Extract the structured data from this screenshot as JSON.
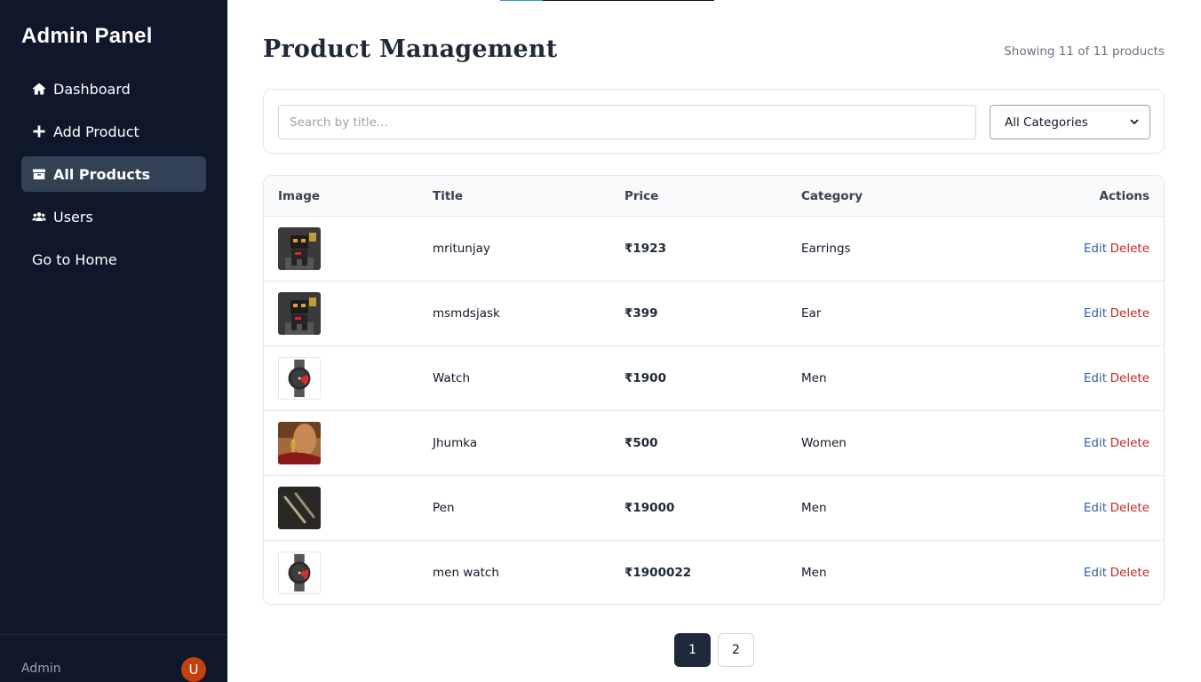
{
  "sidebar": {
    "brand": "Admin Panel",
    "items": [
      {
        "label": "Dashboard",
        "icon": "home-icon",
        "active": false
      },
      {
        "label": "Add Product",
        "icon": "plus-icon",
        "active": false
      },
      {
        "label": "All Products",
        "icon": "box-icon",
        "active": true
      },
      {
        "label": "Users",
        "icon": "users-icon",
        "active": false
      },
      {
        "label": "Go to Home",
        "icon": "",
        "active": false
      }
    ],
    "footer": {
      "user": "Admin",
      "avatar_letter": "U",
      "avatar_color": "#c2410c"
    }
  },
  "main": {
    "title": "Product Management",
    "count_text": "Showing 11 of 11 products",
    "search": {
      "placeholder": "Search by title...",
      "value": ""
    },
    "category_select": {
      "value": "All Categories"
    },
    "table": {
      "headers": {
        "image": "Image",
        "title": "Title",
        "price": "Price",
        "category": "Category",
        "actions": "Actions"
      },
      "rows": [
        {
          "title": "mritunjay",
          "price": "₹1923",
          "category": "Earrings",
          "image": "robot-thumbnail"
        },
        {
          "title": "msmdsjask",
          "price": "₹399",
          "category": "Ear",
          "image": "robot-thumbnail"
        },
        {
          "title": "Watch",
          "price": "₹1900",
          "category": "Men",
          "image": "watch-thumbnail"
        },
        {
          "title": "Jhumka",
          "price": "₹500",
          "category": "Women",
          "image": "jhumka-thumbnail"
        },
        {
          "title": "Pen",
          "price": "₹19000",
          "category": "Men",
          "image": "pen-thumbnail"
        },
        {
          "title": "men watch",
          "price": "₹1900022",
          "category": "Men",
          "image": "watch-thumbnail"
        }
      ],
      "edit_label": "Edit",
      "delete_label": "Delete"
    },
    "pagination": {
      "pages": [
        "1",
        "2"
      ],
      "current": "1"
    }
  },
  "colors": {
    "sidebar_bg": "#0f172a",
    "active_item_bg": "#334155",
    "edit_link": "#3b5ba9",
    "delete_link": "#c02626",
    "active_page_bg": "#1e293b"
  }
}
